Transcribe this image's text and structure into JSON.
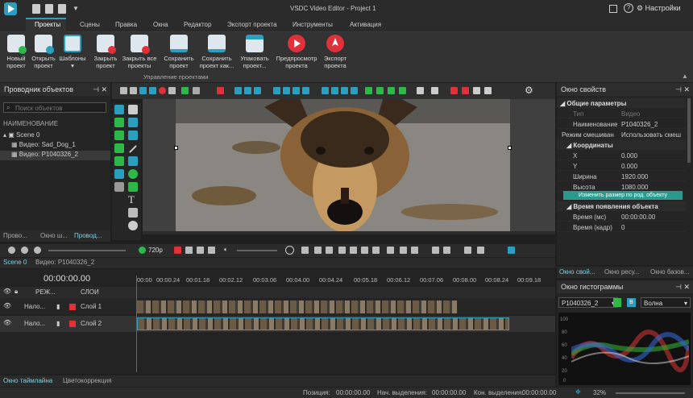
{
  "app": {
    "title": "VSDC Video Editor - Project 1",
    "settings": "Настройки"
  },
  "menu": [
    "Проекты",
    "Сцены",
    "Правка",
    "Окна",
    "Редактор",
    "Экспорт проекта",
    "Инструменты",
    "Активация"
  ],
  "ribbon": {
    "buttons": [
      "Новый проект",
      "Открыть проект",
      "Шаблоны",
      "Закрыть проект",
      "Закрыть все проекты",
      "Сохранить проект",
      "Сохранить проект как...",
      "Упаковать проект...",
      "Предпросмотр проекта",
      "Экспорт проекта"
    ],
    "group_label": "Управление проектами"
  },
  "explorer": {
    "title": "Проводник объектов",
    "search_placeholder": "Поиск объектов",
    "column": "НАИМЕНОВАНИЕ",
    "items": [
      "Scene 0",
      "Видео: Sad_Dog_1",
      "Видео: P1040326_2"
    ],
    "tabs": [
      "Прово...",
      "Окно ш...",
      "Провод..."
    ]
  },
  "props": {
    "title": "Окно свойств",
    "general": "Общие параметры",
    "type_k": "Тип",
    "type_v": "Видео",
    "name_k": "Наименование",
    "name_v": "P1040326_2",
    "blend_k": "Режим смешиван",
    "blend_v": "Использовать смеш",
    "coords": "Координаты",
    "x_k": "X",
    "x_v": "0.000",
    "y_k": "Y",
    "y_v": "0.000",
    "w_k": "Ширина",
    "w_v": "1920.000",
    "h_k": "Высота",
    "h_v": "1080.000",
    "resize_btn": "Изменить размер по род. объекту",
    "appear": "Время появления объекта",
    "tms_k": "Время (мс)",
    "tms_v": "00:00:00.00",
    "tfr_k": "Время (кадр)",
    "tfr_v": "0",
    "tabs": [
      "Окно свой...",
      "Окно ресу...",
      "Окно базов..."
    ]
  },
  "histogram": {
    "title": "Окно гистограммы",
    "source": "P1040326_2",
    "mode": "Волна",
    "axis": [
      "100",
      "80",
      "60",
      "40",
      "20",
      "0"
    ]
  },
  "transport": {
    "quality": "720p"
  },
  "timeline": {
    "tabs": [
      "Scene 0",
      "Видео: P1040326_2"
    ],
    "time": "00:00:00.00",
    "ruler": [
      "00:00",
      "00:00.24",
      "00:01.18",
      "00:02.12",
      "00:03.06",
      "00:04.00",
      "00:04.24",
      "00:05.18",
      "00:06.12",
      "00:07.06",
      "00:08.00",
      "00:08.24",
      "00:09.18"
    ],
    "header_mode": "РЕЖ...",
    "header_layers": "СЛОИ",
    "tracks": [
      {
        "mode": "Нало...",
        "layer": "Слой 1"
      },
      {
        "mode": "Нало...",
        "layer": "Слой 2"
      }
    ]
  },
  "bottom": {
    "tabs": [
      "Окно таймлайна",
      "Цветокоррекция"
    ],
    "pos_k": "Позиция:",
    "pos_v": "00:00:00.00",
    "sel_start_k": "Нач. выделения:",
    "sel_start_v": "00:00:00.00",
    "sel_end_k": "Кон. выделения:",
    "sel_end_v": "00:00:00.00",
    "zoom": "32%"
  }
}
